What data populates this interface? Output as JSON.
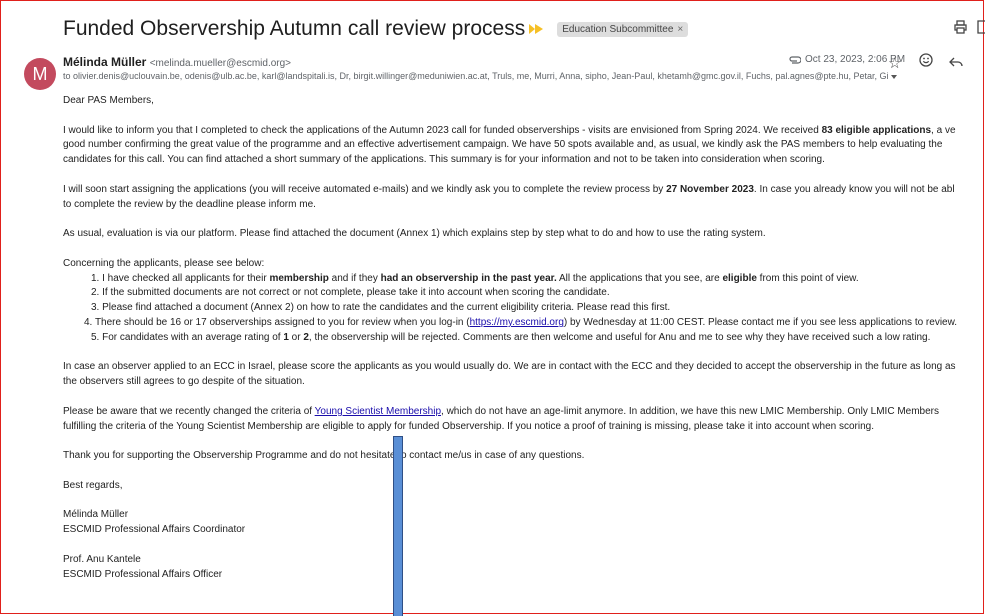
{
  "email": {
    "subject": "Funded Observership Autumn call review process",
    "label": "Education Subcommittee",
    "label_close": "×",
    "sender": {
      "initial": "M",
      "name": "Mélinda Müller",
      "email": "<melinda.mueller@escmid.org>",
      "avatar_color": "#c34a5e"
    },
    "recipients": "to olivier.denis@uclouvain.be, odenis@ulb.ac.be, karl@landspitali.is, Dr, birgit.willinger@meduniwien.ac.at, Truls, me, Murri, Anna, sipho, Jean-Paul, khetamh@gmc.gov.il, Fuchs, pal.agnes@pte.hu, Petar, Gi",
    "date": "Oct 23, 2023, 2:06 PM",
    "icons": [
      "attachment-icon",
      "star-icon",
      "emoji-icon",
      "reply-icon",
      "print-icon",
      "new-window-icon",
      "important-icon"
    ]
  },
  "body": {
    "greeting": "Dear PAS Members,",
    "p1": {
      "l1a": "I would like to inform you that I completed to check the applications of the Autumn 2023 call for funded observerships - visits are envisioned from Spring 2024. We received ",
      "l1b": "83 eligible applications",
      "l1c": ", a ve",
      "l2": "good number confirming the great value of the programme and an effective advertisement campaign. We have 50 spots available and, as usual, we kindly ask the PAS members to help evaluating the",
      "l3": "candidates for this call. You can find attached a short summary of the applications. This summary is for your information and not to be taken into consideration when scoring."
    },
    "p2": {
      "l1a": "I will soon start assigning the applications (you will receive automated e-mails) and we kindly ask you to complete the review process by ",
      "l1b": "27 November 2023",
      "l1c": ". In case you already know you will not be abl",
      "l2": "to complete the review by the deadline please inform me."
    },
    "p3": "As usual, evaluation is via our platform. Please find attached the document (Annex 1) which explains step by step what to do and how to use the rating system.",
    "p4_intro": "Concerning the applicants, please see below:",
    "li1": {
      "a": "1. I have checked all applicants for their ",
      "b": "membership",
      "c": " and if they ",
      "d": "had an observership in the past year.",
      "e": " All the applications that you see, are ",
      "f": "eligible",
      "g": " from this point of view."
    },
    "li2": "2. If the submitted documents are not correct or not complete, please take it into account when scoring the candidate.",
    "li3": "3. Please find attached a document (Annex 2) on how to rate the candidates and the current eligibility criteria. Please read this first.",
    "li4": {
      "a": "4. There should be 16 or 17 observerships assigned to you for review when you log-in (",
      "link": "https://my.escmid.org",
      "b": ") by Wednesday at 11:00 CEST. Please contact me if you see less applications to review."
    },
    "li5": {
      "a": "5. For candidates with an average rating of ",
      "b": "1",
      "c": " or ",
      "d": "2",
      "e": ", the observership will be rejected. Comments are then welcome and useful for Anu and me to see why they have received such a low rating."
    },
    "p5": {
      "l1": "In case an observer applied to an ECC in Israel, please score the applicants as you would usually do. We are in contact with the ECC and they decided to accept the observership in the future as long as",
      "l2": "the observers still agrees to go despite of the situation."
    },
    "p6": {
      "l1a": "Please be aware that we recently changed the criteria of ",
      "link": "Young Scientist Membership",
      "l1b": ", which do not have an age-limit anymore. In addition, we have this new LMIC Membership. Only LMIC Members",
      "l2": "fulfilling the criteria of the Young Scientist Membership are eligible to apply for funded Observership. If you notice a proof of training is missing, please take it into account when scoring."
    },
    "p7": "Thank you for supporting the Observership Programme and do not hesitate to contact me/us in case of any questions.",
    "closing": "Best regards,",
    "sig1_name": "Mélinda Müller",
    "sig1_title": "ESCMID Professional Affairs Coordinator",
    "sig2_name": "Prof. Anu Kantele",
    "sig2_title": "ESCMID Professional Affairs Officer"
  }
}
